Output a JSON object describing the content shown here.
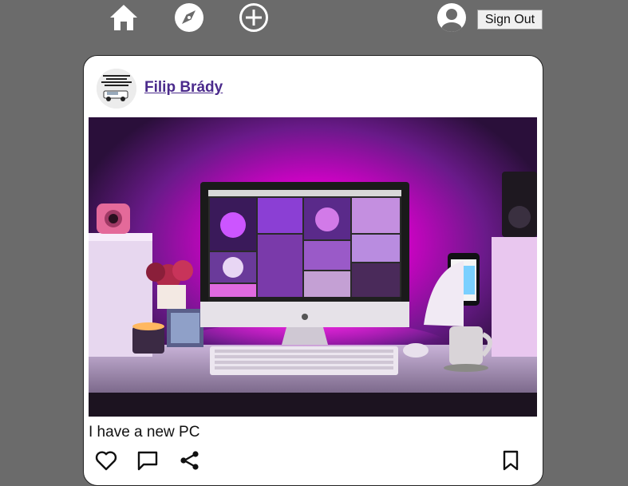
{
  "nav": {
    "items": [
      {
        "name": "home",
        "icon": "home-icon"
      },
      {
        "name": "explore",
        "icon": "compass-icon"
      },
      {
        "name": "create",
        "icon": "add-circle-icon"
      },
      {
        "name": "profile",
        "icon": "user-avatar-icon"
      }
    ],
    "sign_out_label": "Sign Out"
  },
  "post": {
    "author": "Filip Brády",
    "avatar_text": "...s up to times more women than a Lamborghini",
    "caption": "I have a new PC",
    "image_description_icon": "photo",
    "actions": [
      {
        "name": "like",
        "icon": "heart-icon"
      },
      {
        "name": "comment",
        "icon": "comment-icon"
      },
      {
        "name": "share",
        "icon": "share-icon"
      },
      {
        "name": "save",
        "icon": "bookmark-icon"
      }
    ]
  },
  "colors": {
    "background": "#6b6b6b",
    "card": "#ffffff",
    "author_link": "#4b2a8c",
    "accent_glow": "#ff00cc"
  }
}
